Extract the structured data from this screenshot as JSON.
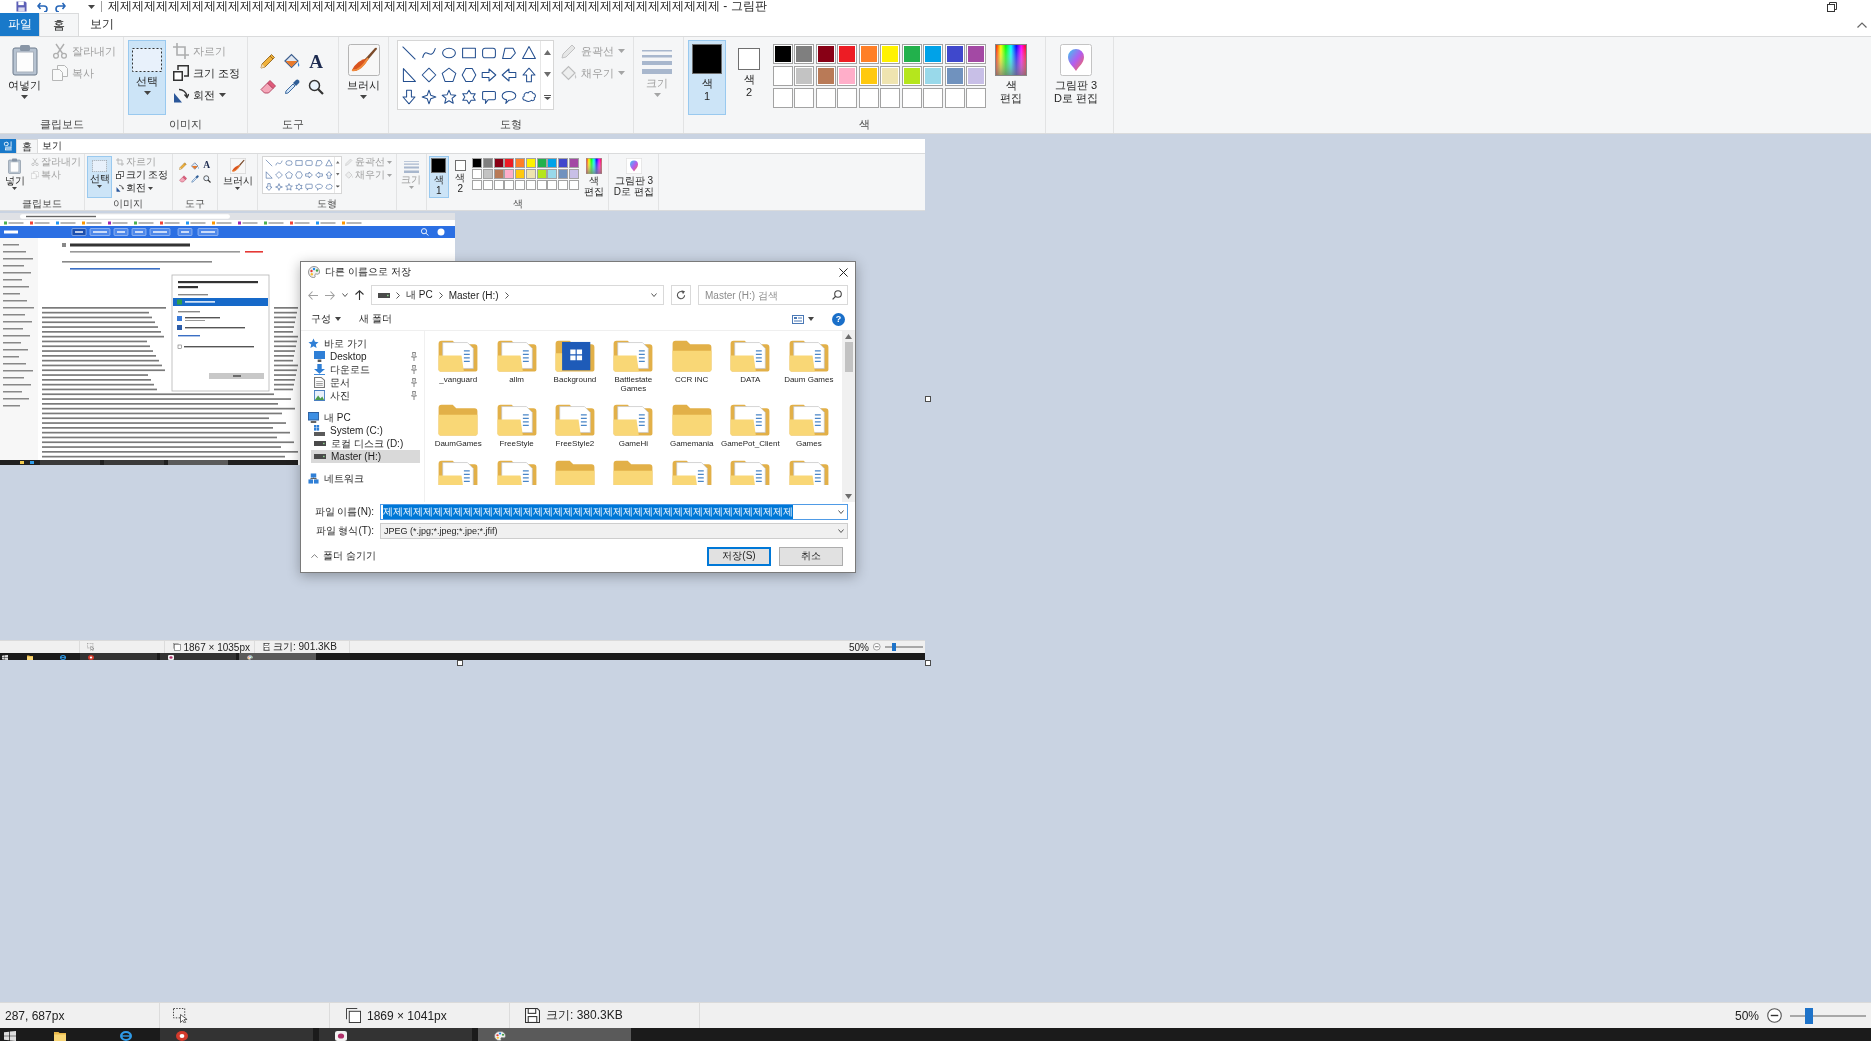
{
  "window": {
    "title": "제제제제제제제제제제제제제제제제제제제제제제제제제제제제제제제제제제제제제제제제제제제제제제제제제제제 - 그림판"
  },
  "menu_tabs": [
    {
      "label": "파일",
      "kind": "file",
      "selected": false
    },
    {
      "label": "홈",
      "kind": "tab",
      "selected": true
    },
    {
      "label": "보기",
      "kind": "tab",
      "selected": false
    }
  ],
  "ribbon": {
    "clipboard": {
      "paste": {
        "label": "여넣기"
      },
      "cut": {
        "label": "잘라내기",
        "disabled": true
      },
      "copy": {
        "label": "복사",
        "disabled": true
      },
      "label": "클립보드"
    },
    "image": {
      "select": {
        "label": "선택",
        "selected": true
      },
      "crop": {
        "label": "자르기",
        "disabled": true
      },
      "resize": {
        "label": "크기 조정",
        "disabled": false
      },
      "rotate": {
        "label": "회전",
        "disabled": false
      },
      "label": "이미지"
    },
    "tools": {
      "text_tool": "A",
      "label": "도구"
    },
    "brushes": {
      "label": "브러시"
    },
    "shapes": {
      "outline": {
        "label": "윤곽선",
        "disabled": true
      },
      "fill": {
        "label": "채우기",
        "disabled": true
      },
      "label": "도형"
    },
    "size": {
      "label": "크기",
      "disabled": true
    },
    "colors": {
      "color_1": {
        "label": "색\n1",
        "color": "#000000",
        "selected": true
      },
      "color_2": {
        "label": "색\n2",
        "color": "#ffffff",
        "selected": false
      },
      "palette": [
        {
          "color": "#000000"
        },
        {
          "color": "#7f7f7f"
        },
        {
          "color": "#880015"
        },
        {
          "color": "#ed1c24"
        },
        {
          "color": "#ff7f27"
        },
        {
          "color": "#fff200"
        },
        {
          "color": "#22b14c"
        },
        {
          "color": "#00a2e8"
        },
        {
          "color": "#3f48cc"
        },
        {
          "color": "#a349a4"
        },
        {
          "color": "#ffffff"
        },
        {
          "color": "#c3c3c3"
        },
        {
          "color": "#b97a57"
        },
        {
          "color": "#ffaec9"
        },
        {
          "color": "#ffc90e"
        },
        {
          "color": "#efe4b0"
        },
        {
          "color": "#b5e61d"
        },
        {
          "color": "#99d9ea"
        },
        {
          "color": "#7092be"
        },
        {
          "color": "#c8bfe7"
        }
      ],
      "edit_colors": {
        "label": "색\n편집"
      },
      "label": "색"
    },
    "paint_3d": {
      "label": "그림판 3\nD로 편집"
    }
  },
  "canvas_image": {
    "menu_tabs": [
      {
        "label": "일",
        "kind": "file",
        "selected": false
      },
      {
        "label": "홈",
        "kind": "tab",
        "selected": true
      },
      {
        "label": "보기",
        "kind": "tab",
        "selected": false
      }
    ],
    "ribbon": {
      "clipboard": {
        "paste": {
          "label": "넣기"
        },
        "cut": {
          "label": "잘라내기",
          "disabled": true
        },
        "copy": {
          "label": "복사",
          "disabled": true
        },
        "label": "클립보드"
      },
      "image": {
        "select": {
          "label": "선택",
          "selected": true
        },
        "crop": {
          "label": "자르기",
          "disabled": true
        },
        "resize": {
          "label": "크기 조정",
          "disabled": false
        },
        "rotate": {
          "label": "회전",
          "disabled": false
        },
        "label": "이미지"
      },
      "tools": {
        "text_tool": "A",
        "label": "도구"
      },
      "brushes": {
        "label": "브러시"
      },
      "shapes": {
        "outline": {
          "label": "윤곽선",
          "disabled": true
        },
        "fill": {
          "label": "채우기",
          "disabled": true
        },
        "label": "도형"
      },
      "size": {
        "label": "크기",
        "disabled": true
      },
      "colors": {
        "color_1": {
          "label": "색\n1",
          "color": "#000000",
          "selected": true
        },
        "color_2": {
          "label": "색\n2",
          "color": "#ffffff",
          "selected": false
        },
        "palette": [
          {
            "color": "#000000"
          },
          {
            "color": "#7f7f7f"
          },
          {
            "color": "#880015"
          },
          {
            "color": "#ed1c24"
          },
          {
            "color": "#ff7f27"
          },
          {
            "color": "#fff200"
          },
          {
            "color": "#22b14c"
          },
          {
            "color": "#00a2e8"
          },
          {
            "color": "#3f48cc"
          },
          {
            "color": "#a349a4"
          },
          {
            "color": "#ffffff"
          },
          {
            "color": "#c3c3c3"
          },
          {
            "color": "#b97a57"
          },
          {
            "color": "#ffaec9"
          },
          {
            "color": "#ffc90e"
          },
          {
            "color": "#efe4b0"
          },
          {
            "color": "#b5e61d"
          },
          {
            "color": "#99d9ea"
          },
          {
            "color": "#7092be"
          },
          {
            "color": "#c8bfe7"
          }
        ],
        "edit_colors": {
          "label": "색\n편집"
        },
        "label": "색"
      },
      "paint_3d": {
        "label": "그림판 3\nD로 편집"
      }
    },
    "save_dialog": {
      "title": "다른 이름으로 저장",
      "address": {
        "breadcrumb": [
          "내 PC",
          "Master (H:)"
        ]
      },
      "search": {
        "placeholder": "Master (H:) 검색"
      },
      "toolbar": {
        "organize": "구성",
        "new_folder": "새 폴더",
        "help": "?"
      },
      "navigation": [
        {
          "label": "바로 가기",
          "kind": "quick_access",
          "selected": false,
          "children": [
            {
              "label": "Desktop",
              "kind": "desktop",
              "pinned": true,
              "selected": false
            },
            {
              "label": "다운로드",
              "kind": "downloads",
              "pinned": true,
              "selected": false
            },
            {
              "label": "문서",
              "kind": "documents",
              "pinned": true,
              "selected": false
            },
            {
              "label": "사진",
              "kind": "pictures",
              "pinned": true,
              "selected": false
            }
          ]
        },
        {
          "label": "내 PC",
          "kind": "pc",
          "selected": false,
          "children": [
            {
              "label": "System (C:)",
              "kind": "system_drive",
              "selected": false
            },
            {
              "label": "로컬 디스크 (D:)",
              "kind": "drive",
              "selected": false
            },
            {
              "label": "Master (H:)",
              "kind": "drive",
              "selected": true
            }
          ]
        },
        {
          "label": "네트워크",
          "kind": "network",
          "selected": false
        }
      ],
      "folders": [
        {
          "name": "_vanguard",
          "kind": "documents"
        },
        {
          "name": "allm",
          "kind": "documents"
        },
        {
          "name": "Background",
          "kind": "picture"
        },
        {
          "name": "Battlestate Games",
          "kind": "documents"
        },
        {
          "name": "CCR INC",
          "kind": "plain"
        },
        {
          "name": "DATA",
          "kind": "documents"
        },
        {
          "name": "Daum Games",
          "kind": "documents"
        },
        {
          "name": "DaumGames",
          "kind": "plain"
        },
        {
          "name": "FreeStyle",
          "kind": "documents"
        },
        {
          "name": "FreeStyle2",
          "kind": "documents"
        },
        {
          "name": "GameHi",
          "kind": "documents"
        },
        {
          "name": "Gamemania",
          "kind": "plain"
        },
        {
          "name": "GamePot_Client",
          "kind": "documents"
        },
        {
          "name": "Games",
          "kind": "documents"
        },
        {
          "kind": "documents"
        },
        {
          "kind": "documents"
        },
        {
          "kind": "plain"
        },
        {
          "kind": "plain"
        },
        {
          "kind": "documents"
        },
        {
          "kind": "documents"
        },
        {
          "kind": "documents"
        }
      ],
      "file_name": {
        "label": "파일 이름(N):",
        "value": "제제제제제제제제제제제제제제제제제제제제제제제제제제제제제제제제제제제제제제제제제",
        "text_selected": true
      },
      "file_type": {
        "label": "파일 형식(T):",
        "value": "JPEG (*.jpg;*.jpeg;*.jpe;*.jfif)"
      },
      "hide_folders": "폴더 숨기기",
      "buttons": [
        {
          "label": "저장(S)",
          "default": true
        },
        {
          "label": "취소",
          "default": false
        }
      ]
    },
    "status_bar": {
      "canvas_size": "1867 × 1035px",
      "file_size": "크기: 901.3KB",
      "zoom": "50%",
      "zoom_slider": {
        "level": 0.25
      }
    },
    "taskbar": {
      "buttons": [
        {
          "kind": "round",
          "selected": false
        },
        {
          "kind": "square",
          "selected": false
        },
        {
          "kind": "paint",
          "selected": true
        }
      ]
    }
  },
  "status_bar": {
    "cursor_position": "287, 687px",
    "canvas_size": "1869 × 1041px",
    "file_size": "크기: 380.3KB",
    "zoom": "50%",
    "zoom_slider": {
      "level": 0.25
    }
  },
  "taskbar": {
    "buttons": [
      {
        "kind": "round",
        "selected": false
      },
      {
        "kind": "square",
        "selected": false
      },
      {
        "kind": "paint",
        "selected": true
      }
    ]
  }
}
